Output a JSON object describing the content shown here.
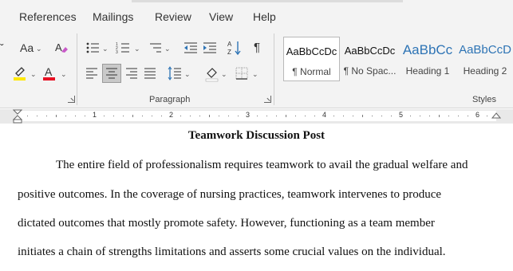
{
  "menu": {
    "tabs": [
      "References",
      "Mailings",
      "Review",
      "View",
      "Help"
    ]
  },
  "ribbon": {
    "font_group": {
      "change_case_label": "Aa",
      "font_color_label": "A",
      "highlight_color": "#ffe800",
      "font_color": "#e81123"
    },
    "paragraph_group": {
      "label": "Paragraph",
      "show_marks_glyph": "¶"
    },
    "styles_group": {
      "label": "Styles",
      "items": [
        {
          "sample": "AaBbCcDc",
          "name": "¶ Normal"
        },
        {
          "sample": "AaBbCcDc",
          "name": "¶ No Spac..."
        },
        {
          "sample": "AaBbCc",
          "name": "Heading 1"
        },
        {
          "sample": "AaBbCcD",
          "name": "Heading 2"
        }
      ],
      "heading_color": "#2e74b5"
    }
  },
  "ruler": {
    "numbers": [
      "1",
      "2",
      "3",
      "4",
      "5",
      "6"
    ]
  },
  "document": {
    "title": "Teamwork Discussion Post",
    "lines": [
      "The entire field of professionalism requires teamwork to avail the gradual welfare and",
      "positive outcomes. In the coverage of nursing practices, teamwork intervenes to produce",
      "dictated outcomes that mostly promote safety. However, functioning as a team member",
      "initiates a chain of strengths limitations and asserts some crucial values on the individual."
    ]
  }
}
